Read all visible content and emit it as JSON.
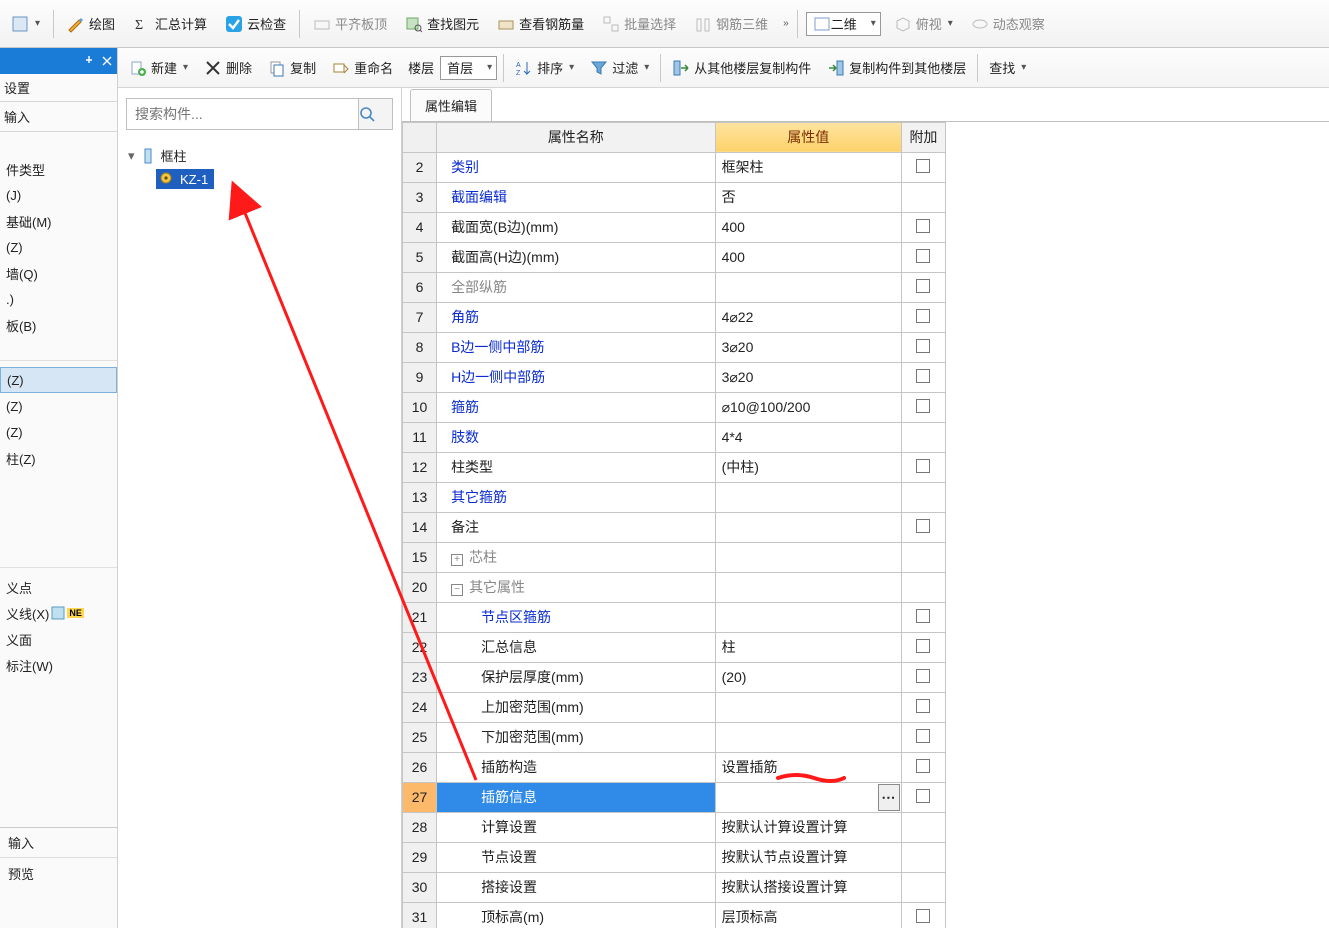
{
  "main_toolbar": {
    "draw": "绘图",
    "sum_calc": "汇总计算",
    "cloud_check": "云检查",
    "align_slab_top": "平齐板顶",
    "find_element": "查找图元",
    "view_rebar_qty": "查看钢筋量",
    "batch_select": "批量选择",
    "rebar_3d": "钢筋三维",
    "view_combo": "二维",
    "overlook": "俯视",
    "dyn_observe": "动态观察"
  },
  "toolbar2": {
    "new": "新建",
    "delete": "删除",
    "copy": "复制",
    "rename": "重命名",
    "floor_label": "楼层",
    "floor_value": "首层",
    "sort": "排序",
    "filter": "过滤",
    "copy_from_floor": "从其他楼层复制构件",
    "copy_to_floor": "复制构件到其他楼层",
    "find": "查找"
  },
  "left": {
    "settings": "设置",
    "input": "输入",
    "items1": [
      "件类型",
      "(J)",
      "基础(M)",
      "(Z)",
      "墙(Q)",
      ".)",
      "板(B)"
    ],
    "group2": [
      "(Z)",
      "(Z)",
      "(Z)",
      "柱(Z)"
    ],
    "group3": [
      "义点",
      "义线(X)",
      "义面",
      "标注(W)"
    ],
    "bottom": [
      "输入",
      "预览"
    ],
    "ne_badge": "NE"
  },
  "tree": {
    "search_placeholder": "搜索构件...",
    "root": "框柱",
    "leaf": "KZ-1"
  },
  "tabs": {
    "prop_edit": "属性编辑"
  },
  "grid": {
    "headers": {
      "name": "属性名称",
      "value": "属性值",
      "add": "附加"
    },
    "rows": [
      {
        "n": 2,
        "name": "类别",
        "blue": true,
        "value": "框架柱",
        "cbx": true
      },
      {
        "n": 3,
        "name": "截面编辑",
        "blue": true,
        "value": "否"
      },
      {
        "n": 4,
        "name": "截面宽(B边)(mm)",
        "value": "400",
        "cbx": true
      },
      {
        "n": 5,
        "name": "截面高(H边)(mm)",
        "value": "400",
        "cbx": true
      },
      {
        "n": 6,
        "name": "全部纵筋",
        "gray": true,
        "value": "",
        "cbx": true
      },
      {
        "n": 7,
        "name": "角筋",
        "blue": true,
        "value": "4⌀22",
        "cbx": true
      },
      {
        "n": 8,
        "name": "B边一侧中部筋",
        "blue": true,
        "value": "3⌀20",
        "cbx": true
      },
      {
        "n": 9,
        "name": "H边一侧中部筋",
        "blue": true,
        "value": "3⌀20",
        "cbx": true
      },
      {
        "n": 10,
        "name": "箍筋",
        "blue": true,
        "value": "⌀10@100/200",
        "cbx": true
      },
      {
        "n": 11,
        "name": "肢数",
        "blue": true,
        "value": "4*4"
      },
      {
        "n": 12,
        "name": "柱类型",
        "value": "(中柱)",
        "cbx": true
      },
      {
        "n": 13,
        "name": "其它箍筋",
        "blue": true,
        "value": ""
      },
      {
        "n": 14,
        "name": "备注",
        "value": "",
        "cbx": true
      },
      {
        "n": 15,
        "name": "芯柱",
        "gray": true,
        "exp": "plus"
      },
      {
        "n": 20,
        "name": "其它属性",
        "gray": true,
        "exp": "minus"
      },
      {
        "n": 21,
        "name": "节点区箍筋",
        "blue": true,
        "pad": true,
        "value": "",
        "cbx": true
      },
      {
        "n": 22,
        "name": "汇总信息",
        "pad": true,
        "value": "柱",
        "cbx": true
      },
      {
        "n": 23,
        "name": "保护层厚度(mm)",
        "pad": true,
        "value": "(20)",
        "cbx": true
      },
      {
        "n": 24,
        "name": "上加密范围(mm)",
        "pad": true,
        "value": "",
        "cbx": true
      },
      {
        "n": 25,
        "name": "下加密范围(mm)",
        "pad": true,
        "value": "",
        "cbx": true
      },
      {
        "n": 26,
        "name": "插筋构造",
        "pad": true,
        "value": "设置插筋",
        "cbx": true
      },
      {
        "n": 27,
        "name": "插筋信息",
        "pad": true,
        "value": "",
        "cbx": true,
        "selected": true,
        "ellipsis": true
      },
      {
        "n": 28,
        "name": "计算设置",
        "pad": true,
        "value": "按默认计算设置计算"
      },
      {
        "n": 29,
        "name": "节点设置",
        "pad": true,
        "value": "按默认节点设置计算"
      },
      {
        "n": 30,
        "name": "搭接设置",
        "pad": true,
        "value": "按默认搭接设置计算"
      },
      {
        "n": 31,
        "name": "顶标高(m)",
        "pad": true,
        "value": "层顶标高",
        "cbx": true
      }
    ]
  }
}
